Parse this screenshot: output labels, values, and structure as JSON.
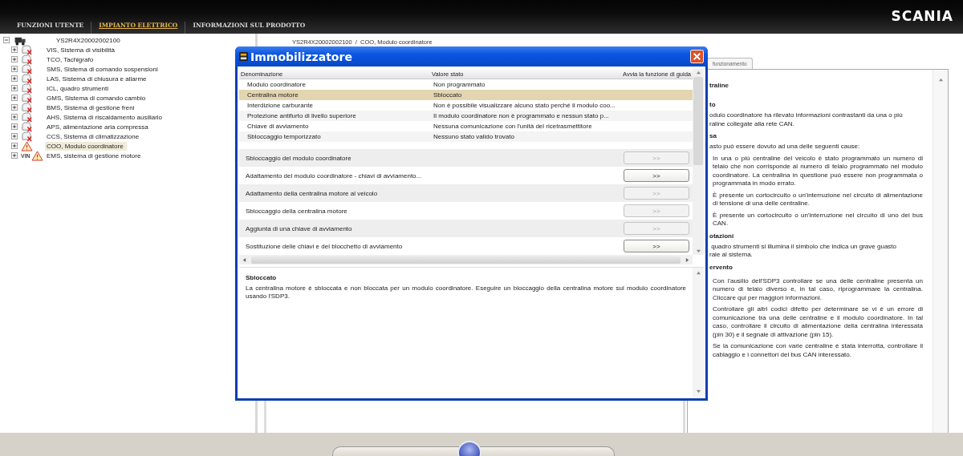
{
  "nav": {
    "tabs": [
      {
        "label": "FUNZIONI UTENTE",
        "selected": false
      },
      {
        "label": "IMPIANTO ELETTRICO",
        "selected": true
      },
      {
        "label": "INFORMAZIONI SUL PRODOTTO",
        "selected": false
      }
    ],
    "logo": "SCANIA"
  },
  "tree": {
    "label": "YS2R4X20002002100",
    "expanded": true,
    "children": [
      {
        "label": "VIS, Sistema di visibilità",
        "kind": "error",
        "expanded": false,
        "selected": false
      },
      {
        "label": "TCO, Tachigrafo",
        "kind": "error",
        "expanded": false,
        "selected": false
      },
      {
        "label": "SMS, Sistema di comando sospensioni",
        "kind": "error",
        "expanded": false,
        "selected": false
      },
      {
        "label": "LAS, Sistema di chiusura e allarme",
        "kind": "error",
        "expanded": false,
        "selected": false
      },
      {
        "label": "ICL, quadro strumenti",
        "kind": "error",
        "expanded": false,
        "selected": false
      },
      {
        "label": "GMS, Sistema di comando cambio",
        "kind": "error",
        "expanded": false,
        "selected": false
      },
      {
        "label": "BMS, Sistema di gestione freni",
        "kind": "error",
        "expanded": false,
        "selected": false
      },
      {
        "label": "AHS, Sistema di riscaldamento ausiliario",
        "kind": "error",
        "expanded": false,
        "selected": false
      },
      {
        "label": "APS, alimentazione aria compressa",
        "kind": "error",
        "expanded": false,
        "selected": false
      },
      {
        "label": "CCS, Sistema di climatizzazione",
        "kind": "error",
        "expanded": false,
        "selected": false
      },
      {
        "label": "COO, Modulo coordinatore",
        "kind": "warning",
        "expanded": false,
        "selected": true
      },
      {
        "label": "EMS, sistema di gestione motore",
        "kind": "vin_warning",
        "badge": "VIN",
        "expanded": false,
        "selected": false
      }
    ]
  },
  "breadcrumb": "YS2R4X20002002100  /  COO, Modulo coordinatore",
  "dialog": {
    "title": "Immobilizzatore",
    "columns": [
      "Denominazione",
      "Valore stato",
      "Avvia la funzione di guida"
    ],
    "rows": [
      {
        "name": "Modulo coordinatore",
        "value": "Non programmato",
        "selected": false
      },
      {
        "name": "Centralina motore",
        "value": "Sbloccato",
        "selected": true
      },
      {
        "name": "Interdizione carburante",
        "value": "Non è possibile visualizzare alcuno stato perché il modulo coo...",
        "selected": false
      },
      {
        "name": "Protezione antifurto di livello superiore",
        "value": "Il modulo coordinatore non è programmato e nessun stato p...",
        "selected": false
      },
      {
        "name": "Chiave di avviamento",
        "value": "Nessuna comunicazione con l'unità del ricetrasmettitore",
        "selected": false
      },
      {
        "name": "Sbloccaggio temporizzato",
        "value": "Nessuno stato valido trovato",
        "selected": false
      }
    ],
    "actions": [
      {
        "label": "Sbloccaggio del modulo coordinatore",
        "button": ">>",
        "disabled": true
      },
      {
        "label": "Adattamento del modulo coordinatore - chiavi di avviamento...",
        "button": ">>",
        "disabled": false
      },
      {
        "label": "Adattamento della centralina motore al veicolo",
        "button": ">>",
        "disabled": true
      },
      {
        "label": "Sbloccaggio della centralina motore",
        "button": ">>",
        "disabled": true
      },
      {
        "label": "Aggiunta di una chiave di avviamento",
        "button": ">>",
        "disabled": true
      },
      {
        "label": "Sostituzione delle chiavi e del blocchetto di avviamento",
        "button": ">>",
        "disabled": false
      }
    ],
    "detail": {
      "title": "Sbloccato",
      "text": "La centralina motore è sbloccata e non bloccata per un modulo coordinatore. Eseguire un bloccaggio della centralina motore sul modulo coordinatore usando l'SDP3."
    }
  },
  "right_panel": {
    "tab": "funzionamento",
    "blocks": [
      {
        "kind": "heading",
        "text": "traline"
      },
      {
        "kind": "heading",
        "text": "to"
      },
      {
        "kind": "line",
        "text": "odulo coordinatore ha rilevato informazioni contrastanti da una o più"
      },
      {
        "kind": "line",
        "text": "raline collegate alla rete CAN."
      },
      {
        "kind": "heading",
        "text": "sa"
      },
      {
        "kind": "line",
        "text": "asto può essere dovuto ad una delle seguenti cause:"
      },
      {
        "kind": "item",
        "text": "In una o più centraline del veicolo è stato programmato un numero di telaio che non corrisponde al numero di telaio programmato nel modulo coordinatore. La centralina in questione può essere non programmata o programmata in modo errato."
      },
      {
        "kind": "item",
        "text": "È presente un cortocircuito o un'interruzione nel circuito di alimentazione di tensione di una delle centraline."
      },
      {
        "kind": "item",
        "text": "È presente un cortocircuito o un'interruzione nel circuito di uno dei bus CAN."
      },
      {
        "kind": "heading",
        "text": "otazioni"
      },
      {
        "kind": "line",
        "text": " quadro strumenti si illumina il simbolo che indica un grave guasto"
      },
      {
        "kind": "line",
        "text": "rale al sistema."
      },
      {
        "kind": "heading",
        "text": "ervento"
      },
      {
        "kind": "item",
        "text": "Con l'ausilio dell'SDP3 controllare se una delle centraline presenta un numero di telaio diverso e, in tal caso, riprogrammare la centralina. Cliccare qui per maggiori informazioni."
      },
      {
        "kind": "item",
        "text": "Controllare gli altri codici difetto per determinare se vi è un errore di comunicazione tra una delle centraline e il modulo coordinatore. In tal caso, controllare il circuito di alimentazione della centralina interessata (pin 30) e il segnale di attivazione (pin 15)."
      },
      {
        "kind": "item",
        "text": "Se la comunicazione con varie centraline è stata interrotta, controllare il cablaggio e i connettori del bus CAN interessato."
      }
    ]
  }
}
